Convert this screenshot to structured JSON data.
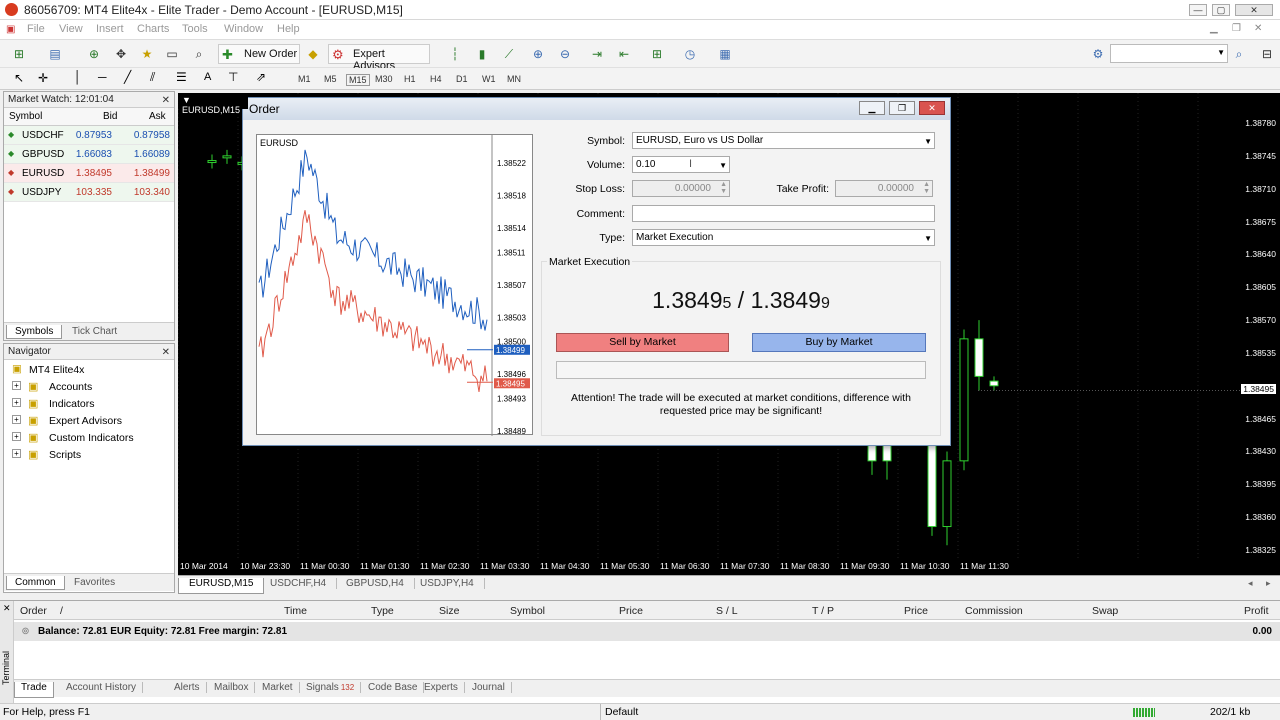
{
  "window": {
    "title": "86056709: MT4 Elite4x - Elite Trader - Demo Account - [EURUSD,M15]",
    "min_label": "—",
    "max_label": "▢",
    "close_label": "✕"
  },
  "menu": [
    "File",
    "View",
    "Insert",
    "Charts",
    "Tools",
    "Window",
    "Help"
  ],
  "toolbar": {
    "new_order_label": "New Order",
    "expert_advisors_label": "Expert Advisors",
    "search_placeholder": ""
  },
  "timeframes": [
    "M1",
    "M5",
    "M15",
    "M30",
    "H1",
    "H4",
    "D1",
    "W1",
    "MN"
  ],
  "market_watch": {
    "title": "Market Watch: 12:01:04",
    "columns": [
      "Symbol",
      "Bid",
      "Ask"
    ],
    "rows": [
      {
        "symbol": "USDCHF",
        "bid": "0.87953",
        "ask": "0.87958",
        "dir": "up"
      },
      {
        "symbol": "GBPUSD",
        "bid": "1.66083",
        "ask": "1.66089",
        "dir": "up"
      },
      {
        "symbol": "EURUSD",
        "bid": "1.38495",
        "ask": "1.38499",
        "dir": "down"
      },
      {
        "symbol": "USDJPY",
        "bid": "103.335",
        "ask": "103.340",
        "dir": "down"
      }
    ],
    "tabs": [
      "Symbols",
      "Tick Chart"
    ]
  },
  "navigator": {
    "title": "Navigator",
    "root": "MT4 Elite4x",
    "items": [
      "Accounts",
      "Indicators",
      "Expert Advisors",
      "Custom Indicators",
      "Scripts"
    ],
    "tabs": [
      "Common",
      "Favorites"
    ]
  },
  "chart": {
    "tab_title": "EURUSD,M15",
    "price_labels": [
      "1.38780",
      "1.38745",
      "1.38710",
      "1.38675",
      "1.38640",
      "1.38605",
      "1.38570",
      "1.38535",
      "1.38465",
      "1.38430",
      "1.38395",
      "1.38360",
      "1.38325"
    ],
    "current_price": "1.38495",
    "time_labels": [
      "10 Mar 2014",
      "10 Mar 23:30",
      "11 Mar 00:30",
      "11 Mar 01:30",
      "11 Mar 02:30",
      "11 Mar 03:30",
      "11 Mar 04:30",
      "11 Mar 05:30",
      "11 Mar 06:30",
      "11 Mar 07:30",
      "11 Mar 08:30",
      "11 Mar 09:30",
      "11 Mar 10:30",
      "11 Mar 11:30"
    ],
    "tabs": [
      "EURUSD,M15",
      "USDCHF,H4",
      "GBPUSD,H4",
      "USDJPY,H4"
    ]
  },
  "order_dialog": {
    "title": "Order",
    "mini_chart_symbol": "EURUSD",
    "mini_price_labels": [
      "1.38522",
      "1.38518",
      "1.38514",
      "1.38511",
      "1.38507",
      "1.38503",
      "1.38500",
      "1.38496",
      "1.38493",
      "1.38489"
    ],
    "mini_ask_tag": "1.38499",
    "mini_bid_tag": "1.38495",
    "symbol_label": "Symbol:",
    "symbol_value": "EURUSD, Euro vs US Dollar",
    "volume_label": "Volume:",
    "volume_value": "0.10",
    "stop_loss_label": "Stop Loss:",
    "stop_loss_value": "0.00000",
    "take_profit_label": "Take Profit:",
    "take_profit_value": "0.00000",
    "comment_label": "Comment:",
    "comment_value": "",
    "type_label": "Type:",
    "type_value": "Market Execution",
    "section_label": "Market Execution",
    "bid_main": "1.3849",
    "bid_last": "5",
    "price_sep": " / ",
    "ask_main": "1.3849",
    "ask_last": "9",
    "sell_label": "Sell by Market",
    "buy_label": "Buy by Market",
    "attention_line1": "Attention! The trade will be executed at market conditions, difference with",
    "attention_line2": "requested price may be significant!"
  },
  "terminal": {
    "side_label": "Terminal",
    "columns": [
      "Order",
      "/",
      "Time",
      "Type",
      "Size",
      "Symbol",
      "Price",
      "S / L",
      "T / P",
      "Price",
      "Commission",
      "Swap",
      "Profit"
    ],
    "balance_text": "Balance: 72.81 EUR  Equity: 72.81  Free margin: 72.81",
    "profit_total": "0.00",
    "tabs": [
      "Trade",
      "Account History",
      "Alerts",
      "Mailbox",
      "Market",
      "Signals",
      "Code Base",
      "Experts",
      "Journal"
    ],
    "signals_badge": "132"
  },
  "status": {
    "help": "For Help, press F1",
    "profile": "Default",
    "traffic": "202/1 kb"
  },
  "colors": {
    "bid_line": "#1f5fbf",
    "ask_line": "#e05a4a",
    "candle": "#2fd12f",
    "sell": "#f08080",
    "buy": "#97b5ec"
  }
}
